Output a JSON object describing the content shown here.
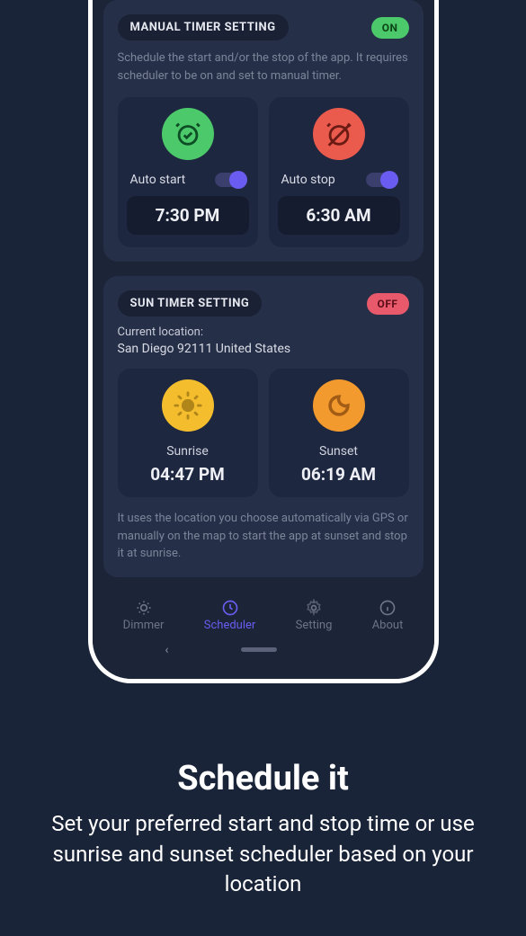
{
  "manual": {
    "title": "MANUAL TIMER SETTING",
    "toggle": "ON",
    "desc": "Schedule the start and/or the stop of the app. It requires scheduler to be on and set to manual timer.",
    "start": {
      "label": "Auto start",
      "time": "7:30 PM"
    },
    "stop": {
      "label": "Auto stop",
      "time": "6:30 AM"
    }
  },
  "sun": {
    "title": "SUN TIMER SETTING",
    "toggle": "OFF",
    "location_label": "Current location:",
    "location": "San Diego 92111 United States",
    "sunrise": {
      "label": "Sunrise",
      "time": "04:47 PM"
    },
    "sunset": {
      "label": "Sunset",
      "time": "06:19 AM"
    },
    "footer": "It uses the location you choose automatically via GPS or manually on the map to start the app at sunset and stop it at sunrise."
  },
  "nav": {
    "dimmer": "Dimmer",
    "scheduler": "Scheduler",
    "setting": "Setting",
    "about": "About"
  },
  "marketing": {
    "title": "Schedule it",
    "sub": "Set your preferred start and stop time or use sunrise and sunset scheduler based on your location"
  }
}
